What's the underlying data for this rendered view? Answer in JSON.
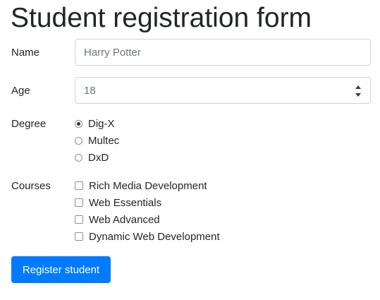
{
  "page": {
    "title": "Student registration form"
  },
  "form": {
    "name": {
      "label": "Name",
      "placeholder": "Harry Potter",
      "value": ""
    },
    "age": {
      "label": "Age",
      "value": "18"
    },
    "degree": {
      "label": "Degree",
      "options": [
        {
          "label": "Dig-X",
          "checked": true
        },
        {
          "label": "Multec",
          "checked": false
        },
        {
          "label": "DxD",
          "checked": false
        }
      ]
    },
    "courses": {
      "label": "Courses",
      "options": [
        {
          "label": "Rich Media Development",
          "checked": false
        },
        {
          "label": "Web Essentials",
          "checked": false
        },
        {
          "label": "Web Advanced",
          "checked": false
        },
        {
          "label": "Dynamic Web Development",
          "checked": false
        }
      ]
    },
    "submit_label": "Register student"
  },
  "colors": {
    "primary": "#007bff",
    "text": "#212529",
    "placeholder": "#6c757d",
    "border": "#ced4da"
  }
}
